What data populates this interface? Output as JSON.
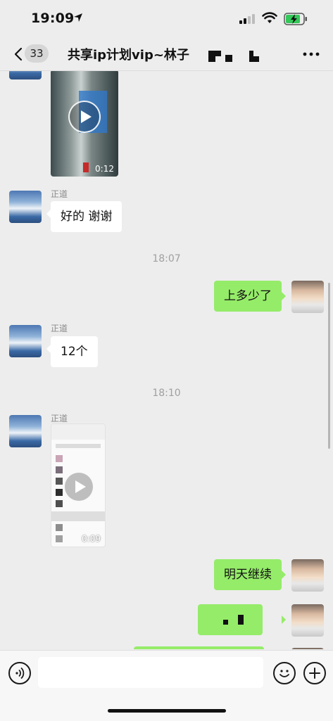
{
  "status": {
    "time": "19:09"
  },
  "nav": {
    "back_count": "33",
    "title": "共享ip计划vip~林子"
  },
  "messages": [
    {
      "sender": "正道",
      "text": "好的  谢谢"
    },
    {
      "timestamp": "18:07"
    },
    {
      "text": "上多少了"
    },
    {
      "sender": "正道",
      "text": "12个"
    },
    {
      "timestamp": "18:10"
    },
    {
      "sender": "正道",
      "video_duration": "0:09"
    },
    {
      "text": "明天继续"
    }
  ],
  "top_video_duration": "0:12",
  "icons": {
    "back": "chevron-left-icon",
    "more": "more-dots-icon",
    "voice": "voice-icon",
    "emoji": "emoji-icon",
    "add": "plus-icon"
  },
  "colors": {
    "sent_bubble": "#95ec69",
    "received_bubble": "#ffffff",
    "background": "#ededed"
  }
}
